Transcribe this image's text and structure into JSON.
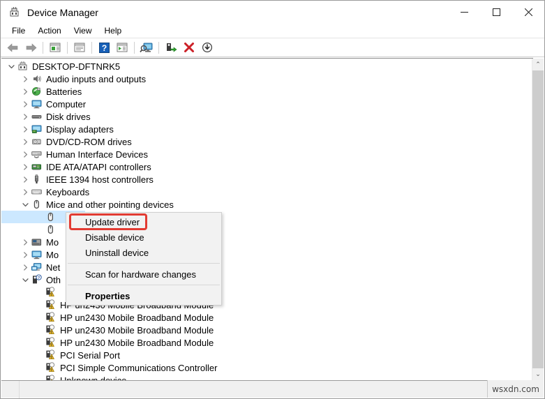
{
  "window": {
    "title": "Device Manager",
    "icon": "device-manager-icon",
    "controls": {
      "minimize": "—",
      "maximize": "□",
      "close": "✕"
    }
  },
  "menubar": {
    "items": [
      {
        "label": "File",
        "name": "menu-file"
      },
      {
        "label": "Action",
        "name": "menu-action"
      },
      {
        "label": "View",
        "name": "menu-view"
      },
      {
        "label": "Help",
        "name": "menu-help"
      }
    ]
  },
  "toolbar": {
    "buttons": [
      {
        "name": "back-button",
        "icon": "back-arrow-icon",
        "tooltip": "Back"
      },
      {
        "name": "forward-button",
        "icon": "forward-arrow-icon",
        "tooltip": "Forward"
      },
      {
        "name": "separator-1",
        "icon": "separator"
      },
      {
        "name": "show-hide-console-tree-button",
        "icon": "console-tree-icon",
        "tooltip": "Show/Hide Console Tree"
      },
      {
        "name": "separator-2",
        "icon": "separator"
      },
      {
        "name": "properties-button",
        "icon": "properties-window-icon",
        "tooltip": "Properties"
      },
      {
        "name": "separator-3",
        "icon": "separator"
      },
      {
        "name": "help-button",
        "icon": "help-question-icon",
        "tooltip": "Help"
      },
      {
        "name": "show-hide-action-pane-button",
        "icon": "action-pane-icon",
        "tooltip": "Show/Hide Action Pane"
      },
      {
        "name": "separator-4",
        "icon": "separator"
      },
      {
        "name": "scan-for-hardware-changes-button",
        "icon": "scan-monitor-icon",
        "tooltip": "Scan for hardware changes"
      },
      {
        "name": "separator-5",
        "icon": "separator"
      },
      {
        "name": "update-driver-button",
        "icon": "update-driver-icon",
        "tooltip": "Update Driver Software"
      },
      {
        "name": "uninstall-device-button",
        "icon": "red-x-icon",
        "tooltip": "Uninstall device"
      },
      {
        "name": "disable-device-button",
        "icon": "disable-arrow-down-icon",
        "tooltip": "Disable device"
      }
    ]
  },
  "tree": {
    "rows": [
      {
        "label": "DESKTOP-DFTNRK5",
        "indent": 0,
        "chevron": "expanded",
        "icon": "computer-root-icon",
        "selected": false
      },
      {
        "label": "Audio inputs and outputs",
        "indent": 1,
        "chevron": "collapsed",
        "icon": "speaker-icon",
        "selected": false
      },
      {
        "label": "Batteries",
        "indent": 1,
        "chevron": "collapsed",
        "icon": "battery-icon",
        "selected": false
      },
      {
        "label": "Computer",
        "indent": 1,
        "chevron": "collapsed",
        "icon": "monitor-icon",
        "selected": false
      },
      {
        "label": "Disk drives",
        "indent": 1,
        "chevron": "collapsed",
        "icon": "disk-drive-icon",
        "selected": false
      },
      {
        "label": "Display adapters",
        "indent": 1,
        "chevron": "collapsed",
        "icon": "display-adapter-icon",
        "selected": false
      },
      {
        "label": "DVD/CD-ROM drives",
        "indent": 1,
        "chevron": "collapsed",
        "icon": "optical-drive-icon",
        "selected": false
      },
      {
        "label": "Human Interface Devices",
        "indent": 1,
        "chevron": "collapsed",
        "icon": "hid-icon",
        "selected": false
      },
      {
        "label": "IDE ATA/ATAPI controllers",
        "indent": 1,
        "chevron": "collapsed",
        "icon": "ide-controller-icon",
        "selected": false
      },
      {
        "label": "IEEE 1394 host controllers",
        "indent": 1,
        "chevron": "collapsed",
        "icon": "ieee1394-icon",
        "selected": false
      },
      {
        "label": "Keyboards",
        "indent": 1,
        "chevron": "collapsed",
        "icon": "keyboard-icon",
        "selected": false
      },
      {
        "label": "Mice and other pointing devices",
        "indent": 1,
        "chevron": "expanded",
        "icon": "mouse-icon",
        "selected": false
      },
      {
        "label": "",
        "indent": 2,
        "chevron": "none",
        "icon": "mouse-icon",
        "selected": true
      },
      {
        "label": "",
        "indent": 2,
        "chevron": "none",
        "icon": "mouse-icon",
        "selected": false
      },
      {
        "label": "Mo",
        "indent": 1,
        "chevron": "collapsed",
        "icon": "modem-icon",
        "selected": false
      },
      {
        "label": "Mo",
        "indent": 1,
        "chevron": "collapsed",
        "icon": "monitor-icon",
        "selected": false
      },
      {
        "label": "Net",
        "indent": 1,
        "chevron": "collapsed",
        "icon": "network-adapter-icon",
        "selected": false
      },
      {
        "label": "Oth",
        "indent": 1,
        "chevron": "expanded",
        "icon": "other-devices-icon",
        "selected": false
      },
      {
        "label": "",
        "indent": 2,
        "chevron": "none",
        "icon": "warning-device-icon",
        "selected": false
      },
      {
        "label": "HP un2430 Mobile Broadband Module",
        "indent": 2,
        "chevron": "none",
        "icon": "warning-device-icon",
        "selected": false
      },
      {
        "label": "HP un2430 Mobile Broadband Module",
        "indent": 2,
        "chevron": "none",
        "icon": "warning-device-icon",
        "selected": false
      },
      {
        "label": "HP un2430 Mobile Broadband Module",
        "indent": 2,
        "chevron": "none",
        "icon": "warning-device-icon",
        "selected": false
      },
      {
        "label": "HP un2430 Mobile Broadband Module",
        "indent": 2,
        "chevron": "none",
        "icon": "warning-device-icon",
        "selected": false
      },
      {
        "label": "PCI Serial Port",
        "indent": 2,
        "chevron": "none",
        "icon": "warning-device-icon",
        "selected": false
      },
      {
        "label": "PCI Simple Communications Controller",
        "indent": 2,
        "chevron": "none",
        "icon": "warning-device-icon",
        "selected": false
      },
      {
        "label": "Unknown device",
        "indent": 2,
        "chevron": "none",
        "icon": "warning-device-icon",
        "selected": false
      }
    ]
  },
  "context_menu": {
    "items": [
      {
        "label": "Update driver",
        "name": "ctx-update-driver",
        "bold": false,
        "highlighted": true
      },
      {
        "label": "Disable device",
        "name": "ctx-disable-device",
        "bold": false,
        "highlighted": false
      },
      {
        "label": "Uninstall device",
        "name": "ctx-uninstall-device",
        "bold": false,
        "highlighted": false
      },
      {
        "separator": true
      },
      {
        "label": "Scan for hardware changes",
        "name": "ctx-scan-for-hardware-changes",
        "bold": false,
        "highlighted": false
      },
      {
        "separator": true
      },
      {
        "label": "Properties",
        "name": "ctx-properties",
        "bold": true,
        "highlighted": false
      }
    ],
    "highlight_color": "#e23b32"
  },
  "statusbar": {
    "text": ""
  },
  "watermark": {
    "text": "wsxdn.com"
  },
  "scrollbar": {
    "up_arrow": "⌃",
    "down_arrow": "⌄"
  }
}
